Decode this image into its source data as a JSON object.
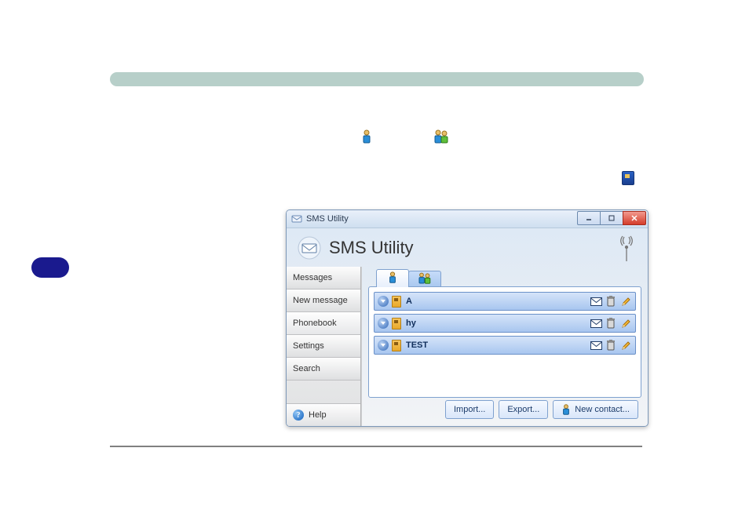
{
  "window": {
    "titlebar": "SMS Utility",
    "app_title": "SMS Utility"
  },
  "sidebar": {
    "items": [
      {
        "label": "Messages"
      },
      {
        "label": "New message"
      },
      {
        "label": "Phonebook"
      },
      {
        "label": "Settings"
      },
      {
        "label": "Search"
      }
    ],
    "help_label": "Help"
  },
  "tabs": {
    "single_contact_icon": "single-contact-icon",
    "group_contact_icon": "group-contact-icon"
  },
  "contacts": [
    {
      "name": "A"
    },
    {
      "name": "hy"
    },
    {
      "name": "TEST"
    }
  ],
  "buttons": {
    "import": "Import...",
    "export": "Export...",
    "new_contact": "New contact..."
  }
}
